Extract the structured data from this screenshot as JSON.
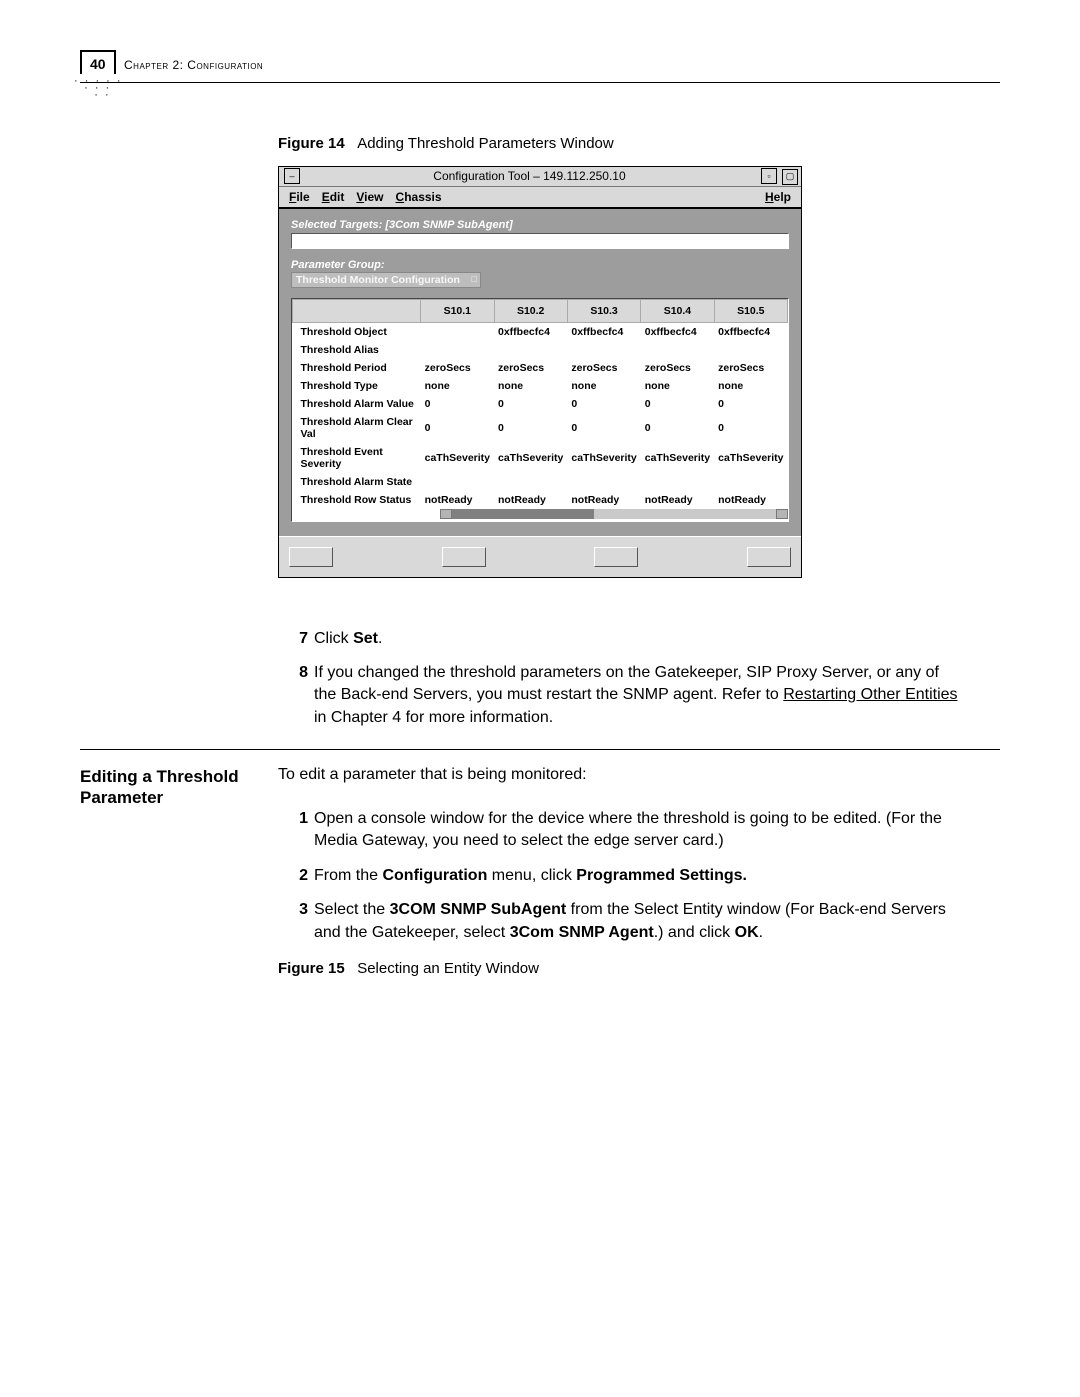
{
  "page": {
    "number": "40",
    "chapter_label": "Chapter 2: Configuration"
  },
  "figure14": {
    "label": "Figure 14",
    "caption": "Adding Threshold Parameters Window"
  },
  "app": {
    "title": "Configuration Tool – 149.112.250.10",
    "menus": {
      "file": "File",
      "edit": "Edit",
      "view": "View",
      "chassis": "Chassis",
      "help": "Help"
    },
    "selected_targets_label": "Selected Targets:  [3Com SNMP SubAgent]",
    "param_group_label": "Parameter Group:",
    "param_group_value": "Threshold Monitor Configuration",
    "columns": [
      "S10.1",
      "S10.2",
      "S10.3",
      "S10.4",
      "S10.5"
    ],
    "rows": [
      {
        "name": "Threshold Object",
        "vals": [
          "",
          "0xffbecfc4",
          "0xffbecfc4",
          "0xffbecfc4",
          "0xffbecfc4"
        ]
      },
      {
        "name": "Threshold Alias",
        "vals": [
          "",
          "",
          "",
          "",
          ""
        ]
      },
      {
        "name": "Threshold Period",
        "vals": [
          "zeroSecs",
          "zeroSecs",
          "zeroSecs",
          "zeroSecs",
          "zeroSecs"
        ]
      },
      {
        "name": "Threshold Type",
        "vals": [
          "none",
          "none",
          "none",
          "none",
          "none"
        ]
      },
      {
        "name": "Threshold Alarm Value",
        "vals": [
          "0",
          "0",
          "0",
          "0",
          "0"
        ]
      },
      {
        "name": "Threshold Alarm Clear Val",
        "vals": [
          "0",
          "0",
          "0",
          "0",
          "0"
        ]
      },
      {
        "name": "Threshold Event Severity",
        "vals": [
          "caThSeverity",
          "caThSeverity",
          "caThSeverity",
          "caThSeverity",
          "caThSeverity"
        ]
      },
      {
        "name": "Threshold Alarm State",
        "vals": [
          "",
          "",
          "",
          "",
          ""
        ]
      },
      {
        "name": "Threshold Row Status",
        "vals": [
          "notReady",
          "notReady",
          "notReady",
          "notReady",
          "notReady"
        ]
      }
    ]
  },
  "steps_a": {
    "s7_pre": "Click ",
    "s7_bold": "Set",
    "s7_post": ".",
    "s8_a": "If you changed the threshold parameters on the Gatekeeper, SIP Proxy Server, or any of the Back-end Servers, you must restart the SNMP agent. Refer to ",
    "s8_link": "Restarting Other Entities",
    "s8_b": " in Chapter 4 for more information."
  },
  "section": {
    "heading": "Editing a Threshold Parameter",
    "lead": "To edit a parameter that is being monitored:",
    "s1": "Open a console window for the device where the threshold is going to be edited. (For the Media Gateway, you need to select the edge server card.)",
    "s2_a": "From the ",
    "s2_b": "Configuration",
    "s2_c": " menu, click ",
    "s2_d": "Programmed Settings.",
    "s3_a": "Select the ",
    "s3_b": "3COM SNMP SubAgent",
    "s3_c": " from the Select Entity window (For Back-end Servers and the Gatekeeper, select ",
    "s3_d": "3Com SNMP Agent",
    "s3_e": ".) and click ",
    "s3_f": "OK",
    "s3_g": "."
  },
  "figure15": {
    "label": "Figure 15",
    "caption": "Selecting an Entity Window"
  },
  "nums": {
    "n1": "1",
    "n2": "2",
    "n3": "3",
    "n7": "7",
    "n8": "8"
  }
}
